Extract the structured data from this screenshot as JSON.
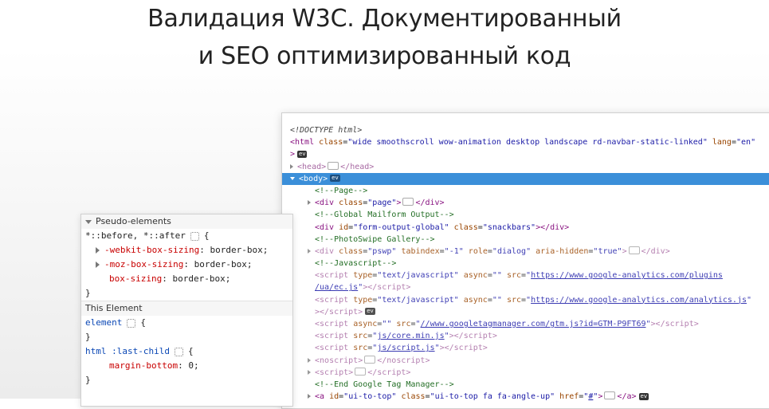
{
  "headline": {
    "line1": "Валидация W3C. Документированный",
    "line2": "и SEO оптимизированный код"
  },
  "styles_panel": {
    "pseudo_section": "Pseudo-elements",
    "pseudo_selector": "*::before, *::after",
    "pseudo_props": [
      {
        "name": "-webkit-box-sizing",
        "value": "border-box"
      },
      {
        "name": "-moz-box-sizing",
        "value": "border-box"
      },
      {
        "name": "box-sizing",
        "value": "border-box"
      }
    ],
    "this_element_section": "This Element",
    "element_selector": "element",
    "rule_selector": "html :last-child",
    "rule_prop": {
      "name": "margin-bottom",
      "value": "0"
    }
  },
  "elements_panel": {
    "doctype": "<!DOCTYPE html>",
    "html_class": "wide smoothscroll wow-animation desktop landscape rd-navbar-static-linked",
    "html_lang": "en",
    "head": "head",
    "body": "body",
    "c_page": "<!--Page-->",
    "div_page_class": "page",
    "c_mailform": "<!--Global Mailform Output-->",
    "div_mailform_id": "form-output-global",
    "div_mailform_class": "snackbars",
    "c_photoswipe": "<!--PhotoSwipe Gallery-->",
    "pswp_class": "pswp",
    "pswp_tabindex": "-1",
    "pswp_role": "dialog",
    "pswp_hidden": "true",
    "c_js": "<!--Javascript-->",
    "script_type": "text/javascript",
    "script_async_empty": "",
    "src_ec_1": "https://www.google-analytics.com/plugins",
    "src_ec_2": "/ua/ec.js",
    "src_analytics": "https://www.google-analytics.com/analytics.js",
    "src_gtm": "//www.googletagmanager.com/gtm.js?id=GTM-P9FT69",
    "src_core": "js/core.min.js",
    "src_script": "js/script.js",
    "noscript": "noscript",
    "script": "script",
    "c_gtm_end": "<!--End Google Tag Manager-->",
    "a_id": "ui-to-top",
    "a_class": "ui-to-top fa fa-angle-up",
    "a_href": "#",
    "ev_label": "ev"
  }
}
